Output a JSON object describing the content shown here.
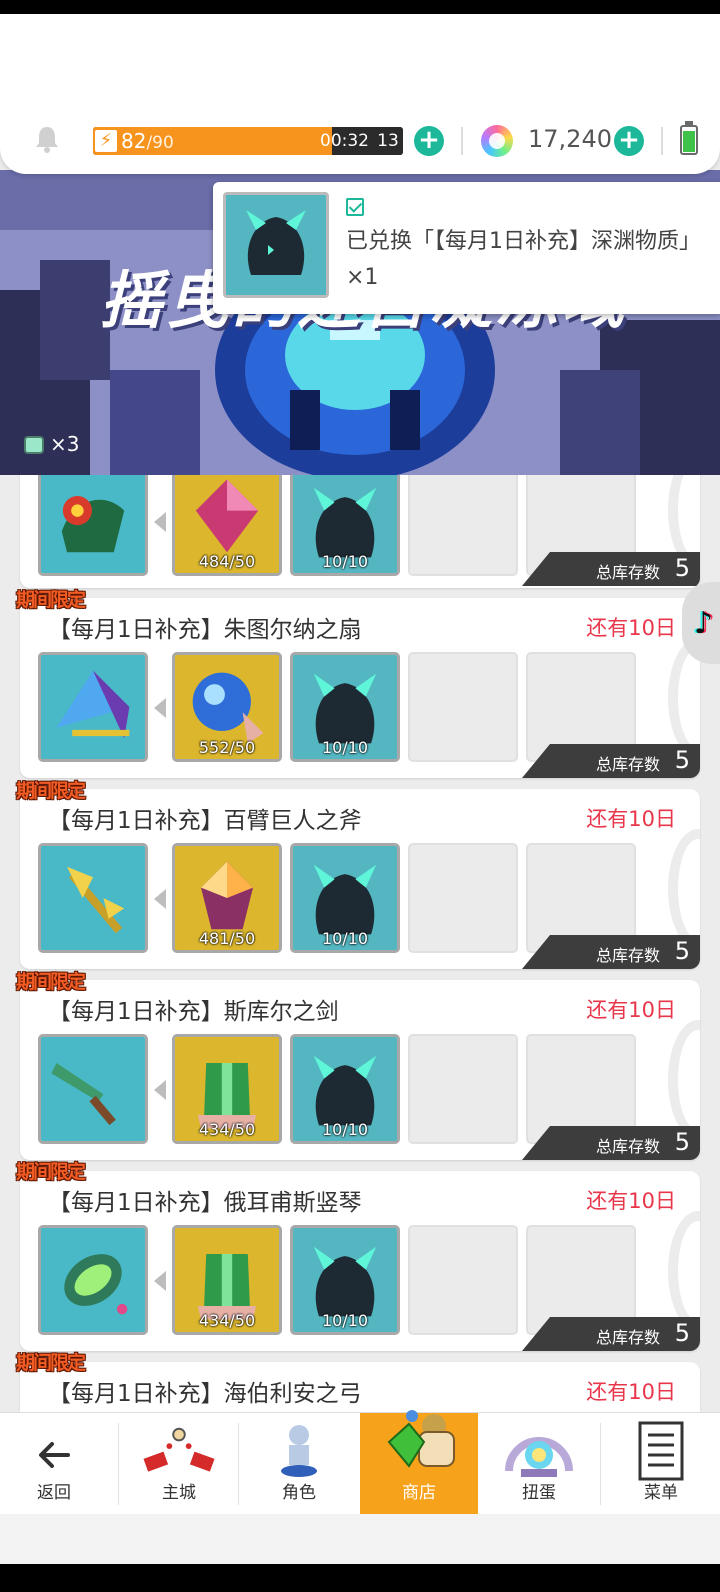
{
  "header": {
    "stamina": {
      "current": "82",
      "max": "/90",
      "timer": "00:32",
      "timer_seconds": "13",
      "fraction": 0.82
    },
    "gems": "17,240"
  },
  "banner": {
    "title": "摇曳的迷宫凝冻域",
    "ticket_count": "×3"
  },
  "toast": {
    "message": "已兑换「【每月1日补充】深渊物质」 ×1"
  },
  "list": {
    "limited_tag": "期间限定",
    "stock_label": "总库存数",
    "top_partial": {
      "mat1_count": "484/50",
      "mat2_count": "10/10",
      "stock": "5"
    },
    "items": [
      {
        "title": "【每月1日补充】朱图尔纳之扇",
        "days_left": "还有10日",
        "mat1_count": "552/50",
        "mat2_count": "10/10",
        "stock": "5"
      },
      {
        "title": "【每月1日补充】百臂巨人之斧",
        "days_left": "还有10日",
        "mat1_count": "481/50",
        "mat2_count": "10/10",
        "stock": "5"
      },
      {
        "title": "【每月1日补充】斯库尔之剑",
        "days_left": "还有10日",
        "mat1_count": "434/50",
        "mat2_count": "10/10",
        "stock": "5"
      },
      {
        "title": "【每月1日补充】俄耳甫斯竖琴",
        "days_left": "还有10日",
        "mat1_count": "434/50",
        "mat2_count": "10/10",
        "stock": "5"
      },
      {
        "title": "【每月1日补充】海伯利安之弓",
        "days_left": "还有10日"
      }
    ]
  },
  "nav": {
    "back": "返回",
    "home": "主城",
    "character": "角色",
    "shop": "商店",
    "gacha": "扭蛋",
    "menu": "菜单"
  },
  "colors": {
    "accent": "#1db89a",
    "stamina": "#f7941d",
    "active_tab": "#f7a21b",
    "days_left": "#e8364b",
    "limited": "#f25c24"
  }
}
